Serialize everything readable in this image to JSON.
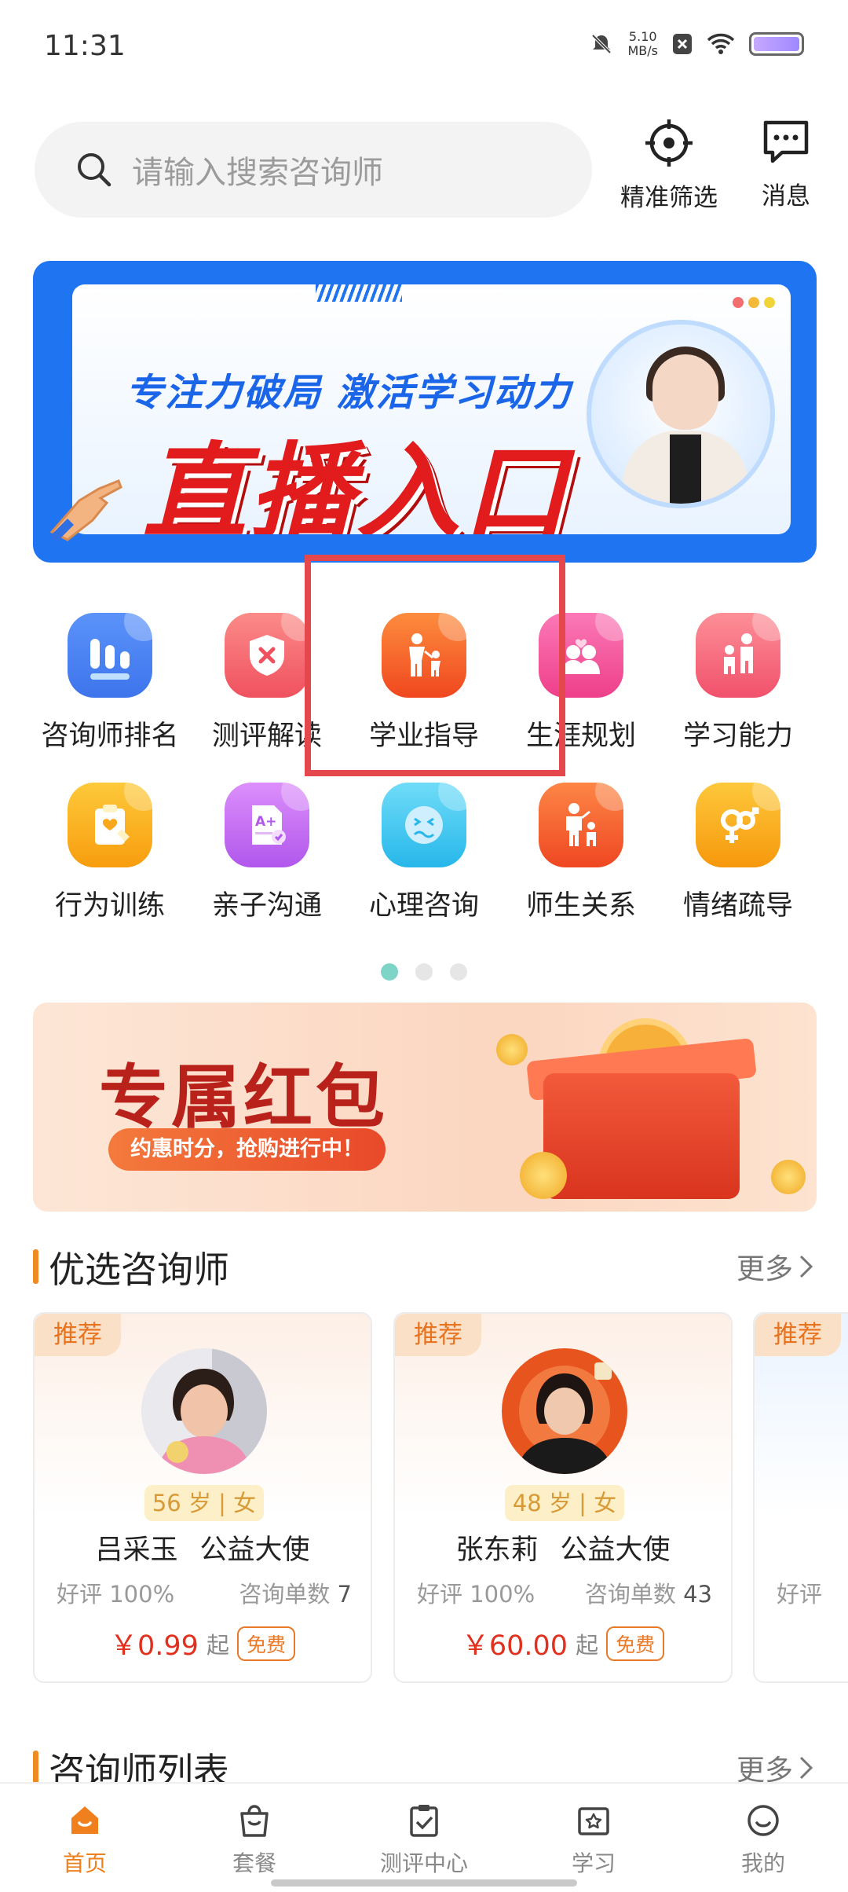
{
  "status_bar": {
    "time": "11:31",
    "speed_value": "5.10",
    "speed_unit": "MB/s"
  },
  "search": {
    "placeholder": "请输入搜索咨询师"
  },
  "top_actions": {
    "filter_label": "精准筛选",
    "message_label": "消息"
  },
  "live_banner": {
    "subtitle": "专注力破局 激活学习动力",
    "title": "直播入口"
  },
  "categories": [
    {
      "label": "咨询师排名",
      "icon": "bar-chart-icon",
      "color": "#4f86f7"
    },
    {
      "label": "测评解读",
      "icon": "shield-x-icon",
      "color": "#f4606e"
    },
    {
      "label": "学业指导",
      "icon": "parent-child-icon",
      "color": "#f56a2c"
    },
    {
      "label": "生涯规划",
      "icon": "couple-heart-icon",
      "color": "#f25a9a"
    },
    {
      "label": "学习能力",
      "icon": "family-icon",
      "color": "#f5617a"
    },
    {
      "label": "行为训练",
      "icon": "clipboard-heart-icon",
      "color": "#f8a81a"
    },
    {
      "label": "亲子沟通",
      "icon": "document-grade-icon",
      "color": "#c46cf0"
    },
    {
      "label": "心理咨询",
      "icon": "sad-face-icon",
      "color": "#3cc6ee"
    },
    {
      "label": "师生关系",
      "icon": "teacher-student-icon",
      "color": "#f4642e"
    },
    {
      "label": "情绪疏导",
      "icon": "gender-icon",
      "color": "#f9a41e"
    }
  ],
  "promo": {
    "title": "专属红包",
    "subtitle": "约惠时分，抢购进行中！"
  },
  "featured_section": {
    "title": "优选咨询师",
    "more": "更多"
  },
  "counselors": [
    {
      "tag": "推荐",
      "age": "56 岁 | 女",
      "name": "吕采玉",
      "role": "公益大使",
      "rating": "好评 100%",
      "orders_label": "咨询单数",
      "orders": "7",
      "price": "￥0.99",
      "from": "起",
      "badge": "免费"
    },
    {
      "tag": "推荐",
      "age": "48 岁 | 女",
      "name": "张东莉",
      "role": "公益大使",
      "rating": "好评 100%",
      "orders_label": "咨询单数",
      "orders": "43",
      "price": "￥60.00",
      "from": "起",
      "badge": "免费"
    },
    {
      "tag": "推荐",
      "rating": "好评"
    }
  ],
  "list_section": {
    "title": "咨询师列表",
    "more": "更多"
  },
  "bottom_nav": [
    {
      "label": "首页",
      "icon": "home-icon",
      "active": true
    },
    {
      "label": "套餐",
      "icon": "shopping-bag-icon"
    },
    {
      "label": "测评中心",
      "icon": "clipboard-check-icon"
    },
    {
      "label": "学习",
      "icon": "star-box-icon"
    },
    {
      "label": "我的",
      "icon": "smiley-icon"
    }
  ],
  "colors": {
    "accent": "#f07f1e",
    "banner_blue": "#1f74f2",
    "price_red": "#e2301e",
    "highlight": "#e4474c"
  }
}
